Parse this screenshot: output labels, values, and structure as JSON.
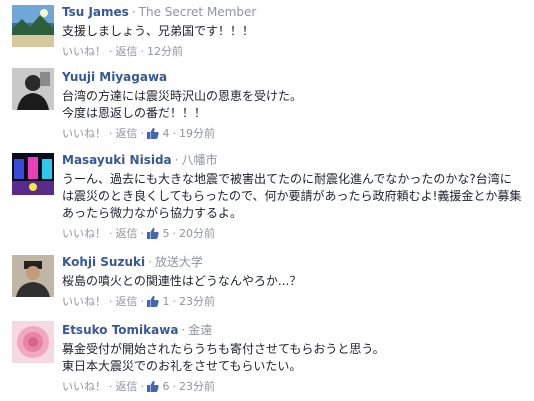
{
  "comments": [
    {
      "name": "Tsu James",
      "meta": "The Secret Member",
      "text": [
        "支援しましょう、兄弟国です！！！"
      ],
      "like_label": "いいね！",
      "reply_label": "返信",
      "likes": "",
      "time": "12分前",
      "avatar_icon": "landscape-avatar"
    },
    {
      "name": "Yuuji Miyagawa",
      "meta": "",
      "text": [
        "台湾の方達には震災時沢山の恩恵を受けた。",
        "今度は恩返しの番だ！！！"
      ],
      "like_label": "いいね！",
      "reply_label": "返信",
      "likes": "4",
      "time": "19分前",
      "avatar_icon": "person-avatar"
    },
    {
      "name": "Masayuki Nisida",
      "meta": "八幡市",
      "text": [
        "うーん、過去にも大きな地震で被害出てたのに耐震化進んでなかったのかな?台湾に",
        "は震災のとき良くしてもらったので、何か要請があったら政府頼むよ!義援金とか募集",
        "あったら微力ながら協力するよ。"
      ],
      "like_label": "いいね！",
      "reply_label": "返信",
      "likes": "5",
      "time": "20分前",
      "avatar_icon": "arcade-avatar"
    },
    {
      "name": "Kohji Suzuki",
      "meta": "放送大学",
      "text": [
        "桜島の噴火との関連性はどうなんやろか...？"
      ],
      "like_label": "いいね！",
      "reply_label": "返信",
      "likes": "1",
      "time": "23分前",
      "avatar_icon": "person-avatar"
    },
    {
      "name": "Etsuko Tomikawa",
      "meta": "金遠",
      "text": [
        "募金受付が開始されたらうちも寄付させてもらおうと思う。",
        "東日本大震災でのお礼をさせてもらいたい。"
      ],
      "like_label": "いいね！",
      "reply_label": "返信",
      "likes": "6",
      "time": "23分前",
      "avatar_icon": "rose-avatar"
    }
  ],
  "colors": {
    "name": "#365899",
    "meta": "#90949c",
    "text": "#1d2129",
    "like_icon": "#4267b2"
  }
}
